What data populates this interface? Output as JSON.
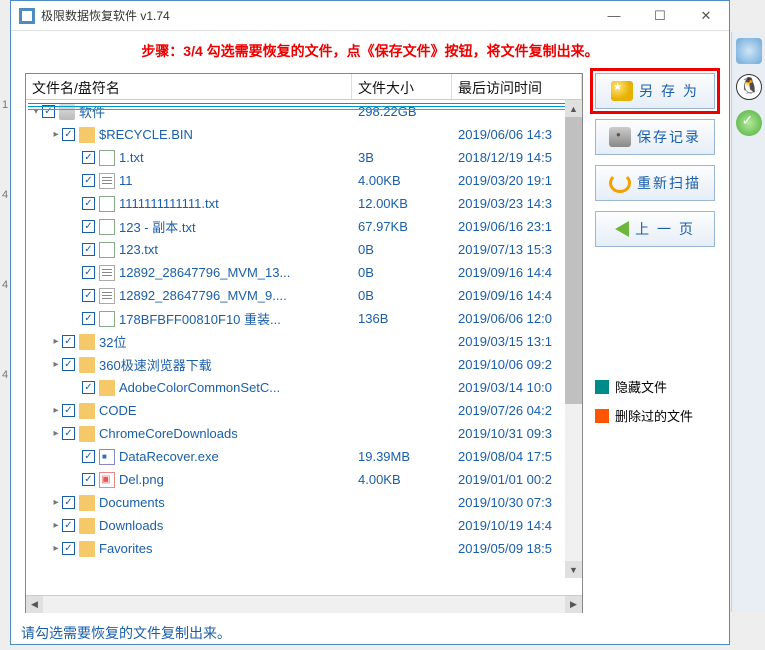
{
  "titlebar": {
    "title": "极限数据恢复软件 v1.74"
  },
  "instruction": "步骤：3/4 勾选需要恢复的文件，点《保存文件》按钮，将文件复制出来。",
  "columns": {
    "name": "文件名/盘符名",
    "size": "文件大小",
    "time": "最后访问时间"
  },
  "rows": [
    {
      "indent": 0,
      "arrow": "▾",
      "icon": "drive",
      "name": "软件",
      "size": "298.22GB",
      "time": ""
    },
    {
      "indent": 1,
      "arrow": "▸",
      "icon": "folder",
      "name": "$RECYCLE.BIN",
      "size": "",
      "time": "2019/06/06 14:3"
    },
    {
      "indent": 2,
      "arrow": "",
      "icon": "txtcolor",
      "name": "1.txt",
      "size": "3B",
      "time": "2018/12/19 14:5"
    },
    {
      "indent": 2,
      "arrow": "",
      "icon": "txt",
      "name": "11",
      "size": "4.00KB",
      "time": "2019/03/20 19:1"
    },
    {
      "indent": 2,
      "arrow": "",
      "icon": "txtcolor",
      "name": "1111111111111.txt",
      "size": "12.00KB",
      "time": "2019/03/23 14:3"
    },
    {
      "indent": 2,
      "arrow": "",
      "icon": "txtcolor",
      "name": "123 - 副本.txt",
      "size": "67.97KB",
      "time": "2019/06/16 23:1"
    },
    {
      "indent": 2,
      "arrow": "",
      "icon": "txtcolor",
      "name": "123.txt",
      "size": "0B",
      "time": "2019/07/13 15:3"
    },
    {
      "indent": 2,
      "arrow": "",
      "icon": "txt",
      "name": "12892_28647796_MVM_13...",
      "size": "0B",
      "time": "2019/09/16 14:4"
    },
    {
      "indent": 2,
      "arrow": "",
      "icon": "txt",
      "name": "12892_28647796_MVM_9....",
      "size": "0B",
      "time": "2019/09/16 14:4"
    },
    {
      "indent": 2,
      "arrow": "",
      "icon": "txtcolor",
      "name": "178BFBFF00810F10  重装...",
      "size": "136B",
      "time": "2019/06/06 12:0"
    },
    {
      "indent": 1,
      "arrow": "▸",
      "icon": "folder",
      "name": "32位",
      "size": "",
      "time": "2019/03/15 13:1"
    },
    {
      "indent": 1,
      "arrow": "▸",
      "icon": "folder",
      "name": "360极速浏览器下载",
      "size": "",
      "time": "2019/10/06 09:2"
    },
    {
      "indent": 2,
      "arrow": "",
      "icon": "folder",
      "name": "AdobeColorCommonSetC...",
      "size": "",
      "time": "2019/03/14 10:0"
    },
    {
      "indent": 1,
      "arrow": "▸",
      "icon": "folder",
      "name": "CODE",
      "size": "",
      "time": "2019/07/26 04:2"
    },
    {
      "indent": 1,
      "arrow": "▸",
      "icon": "folder",
      "name": "ChromeCoreDownloads",
      "size": "",
      "time": "2019/10/31 09:3"
    },
    {
      "indent": 2,
      "arrow": "",
      "icon": "exe",
      "name": "DataRecover.exe",
      "size": "19.39MB",
      "time": "2019/08/04 17:5"
    },
    {
      "indent": 2,
      "arrow": "",
      "icon": "img",
      "name": "Del.png",
      "size": "4.00KB",
      "time": "2019/01/01 00:2"
    },
    {
      "indent": 1,
      "arrow": "▸",
      "icon": "folder",
      "name": "Documents",
      "size": "",
      "time": "2019/10/30 07:3"
    },
    {
      "indent": 1,
      "arrow": "▸",
      "icon": "folder",
      "name": "Downloads",
      "size": "",
      "time": "2019/10/19 14:4"
    },
    {
      "indent": 1,
      "arrow": "▸",
      "icon": "folder",
      "name": "Favorites",
      "size": "",
      "time": "2019/05/09 18:5"
    }
  ],
  "actions": {
    "save_as": "另 存 为",
    "save_record": "保存记录",
    "rescan": "重新扫描",
    "prev": "上 一 页"
  },
  "legend": {
    "hidden": "隐藏文件",
    "deleted": "删除过的文件"
  },
  "status": "请勾选需要恢复的文件复制出来。"
}
